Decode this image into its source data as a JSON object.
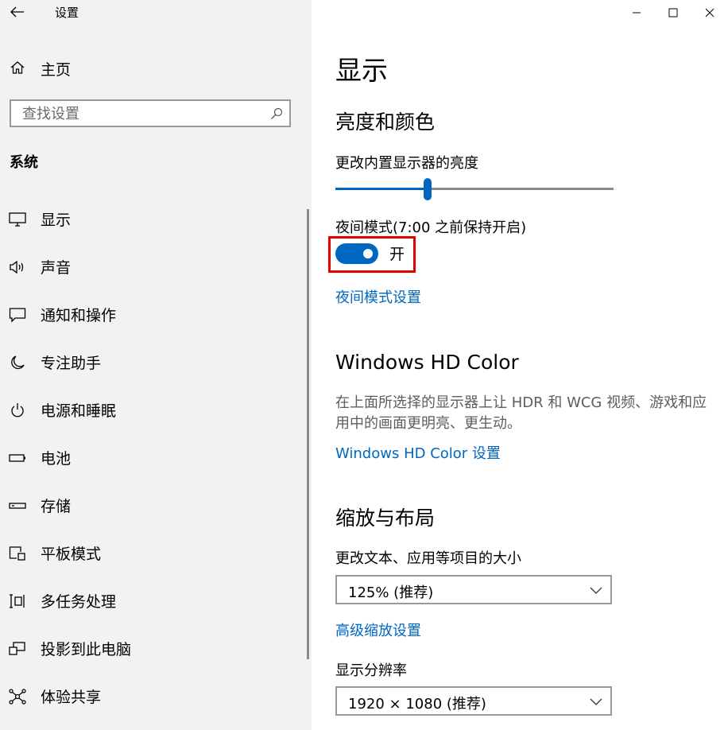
{
  "window": {
    "app_title": "设置",
    "controls": [
      "minimize-icon",
      "maximize-icon",
      "close-icon"
    ]
  },
  "sidebar": {
    "home_label": "主页",
    "search_placeholder": "查找设置",
    "section_title": "系统",
    "items": [
      {
        "label": "显示",
        "icon": "monitor-icon"
      },
      {
        "label": "声音",
        "icon": "speaker-icon"
      },
      {
        "label": "通知和操作",
        "icon": "notification-icon"
      },
      {
        "label": "专注助手",
        "icon": "moon-icon"
      },
      {
        "label": "电源和睡眠",
        "icon": "power-icon"
      },
      {
        "label": "电池",
        "icon": "battery-icon"
      },
      {
        "label": "存储",
        "icon": "storage-icon"
      },
      {
        "label": "平板模式",
        "icon": "tablet-mode-icon"
      },
      {
        "label": "多任务处理",
        "icon": "multitasking-icon"
      },
      {
        "label": "投影到此电脑",
        "icon": "project-icon"
      },
      {
        "label": "体验共享",
        "icon": "shared-experience-icon"
      }
    ]
  },
  "main": {
    "page_title": "显示",
    "brightness": {
      "heading": "亮度和颜色",
      "slider_label": "更改内置显示器的亮度",
      "slider_value": 0.33
    },
    "night_light": {
      "label": "夜间模式(7:00 之前保持开启)",
      "state": "开",
      "enabled": true,
      "settings_link": "夜间模式设置"
    },
    "hd_color": {
      "heading": "Windows HD Color",
      "description": "在上面所选择的显示器上让 HDR 和 WCG 视频、游戏和应用中的画面更明亮、更生动。",
      "settings_link": "Windows HD Color 设置"
    },
    "scale_layout": {
      "heading": "缩放与布局",
      "scale_label": "更改文本、应用等项目的大小",
      "scale_value": "125% (推荐)",
      "advanced_link": "高级缩放设置",
      "resolution_label": "显示分辨率",
      "resolution_value": "1920 × 1080 (推荐)"
    }
  },
  "colors": {
    "accent": "#0067c0",
    "highlight": "#e10000",
    "sidebar_bg": "#f2f2f2"
  }
}
